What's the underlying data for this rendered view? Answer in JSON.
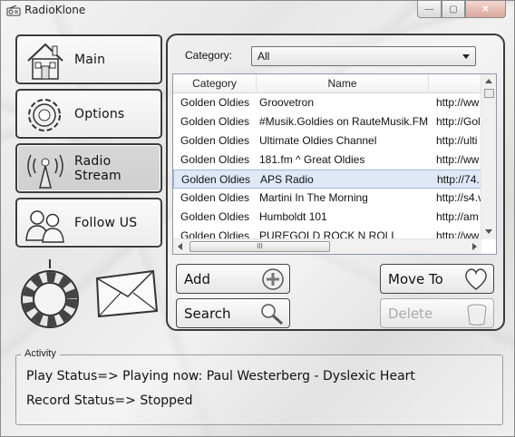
{
  "window": {
    "title": "RadioKlone",
    "close_glyph": "✕",
    "min_glyph": "—",
    "max_glyph": "▢"
  },
  "nav": [
    {
      "label": "Main",
      "icon": "house-icon"
    },
    {
      "label": "Options",
      "icon": "gear-icon"
    },
    {
      "label": "Radio Stream",
      "icon": "radio-tower-icon",
      "active": true
    },
    {
      "label": "Follow US",
      "icon": "people-icon"
    }
  ],
  "category": {
    "label": "Category:",
    "selected": "All"
  },
  "table": {
    "columns": [
      "Category",
      "Name",
      ""
    ],
    "rows": [
      {
        "category": "Golden Oldies",
        "name": "Groovetron",
        "url": "http://ww"
      },
      {
        "category": "Golden Oldies",
        "name": "#Musik.Goldies on RauteMusik.FM",
        "url": "http://Gol"
      },
      {
        "category": "Golden Oldies",
        "name": "Ultimate Oldies Channel",
        "url": "http://ulti"
      },
      {
        "category": "Golden Oldies",
        "name": "181.fm ^ Great Oldies",
        "url": "http://ww"
      },
      {
        "category": "Golden Oldies",
        "name": "APS Radio",
        "url": "http://74.",
        "selected": true
      },
      {
        "category": "Golden Oldies",
        "name": "Martini In The Morning",
        "url": "http://s4.v"
      },
      {
        "category": "Golden Oldies",
        "name": "Humboldt 101",
        "url": "http://am"
      },
      {
        "category": "Golden Oldies",
        "name": "PUREGOLD ROCK N ROLL",
        "url": "http://ww"
      }
    ],
    "hscroll_thumb": "III"
  },
  "actions": {
    "add": "Add",
    "search": "Search",
    "move": "Move To",
    "delete": "Delete"
  },
  "activity": {
    "title": "Activity",
    "play": "Play Status=> Playing now: Paul Westerberg - Dyslexic Heart",
    "record": "Record Status=> Stopped"
  }
}
